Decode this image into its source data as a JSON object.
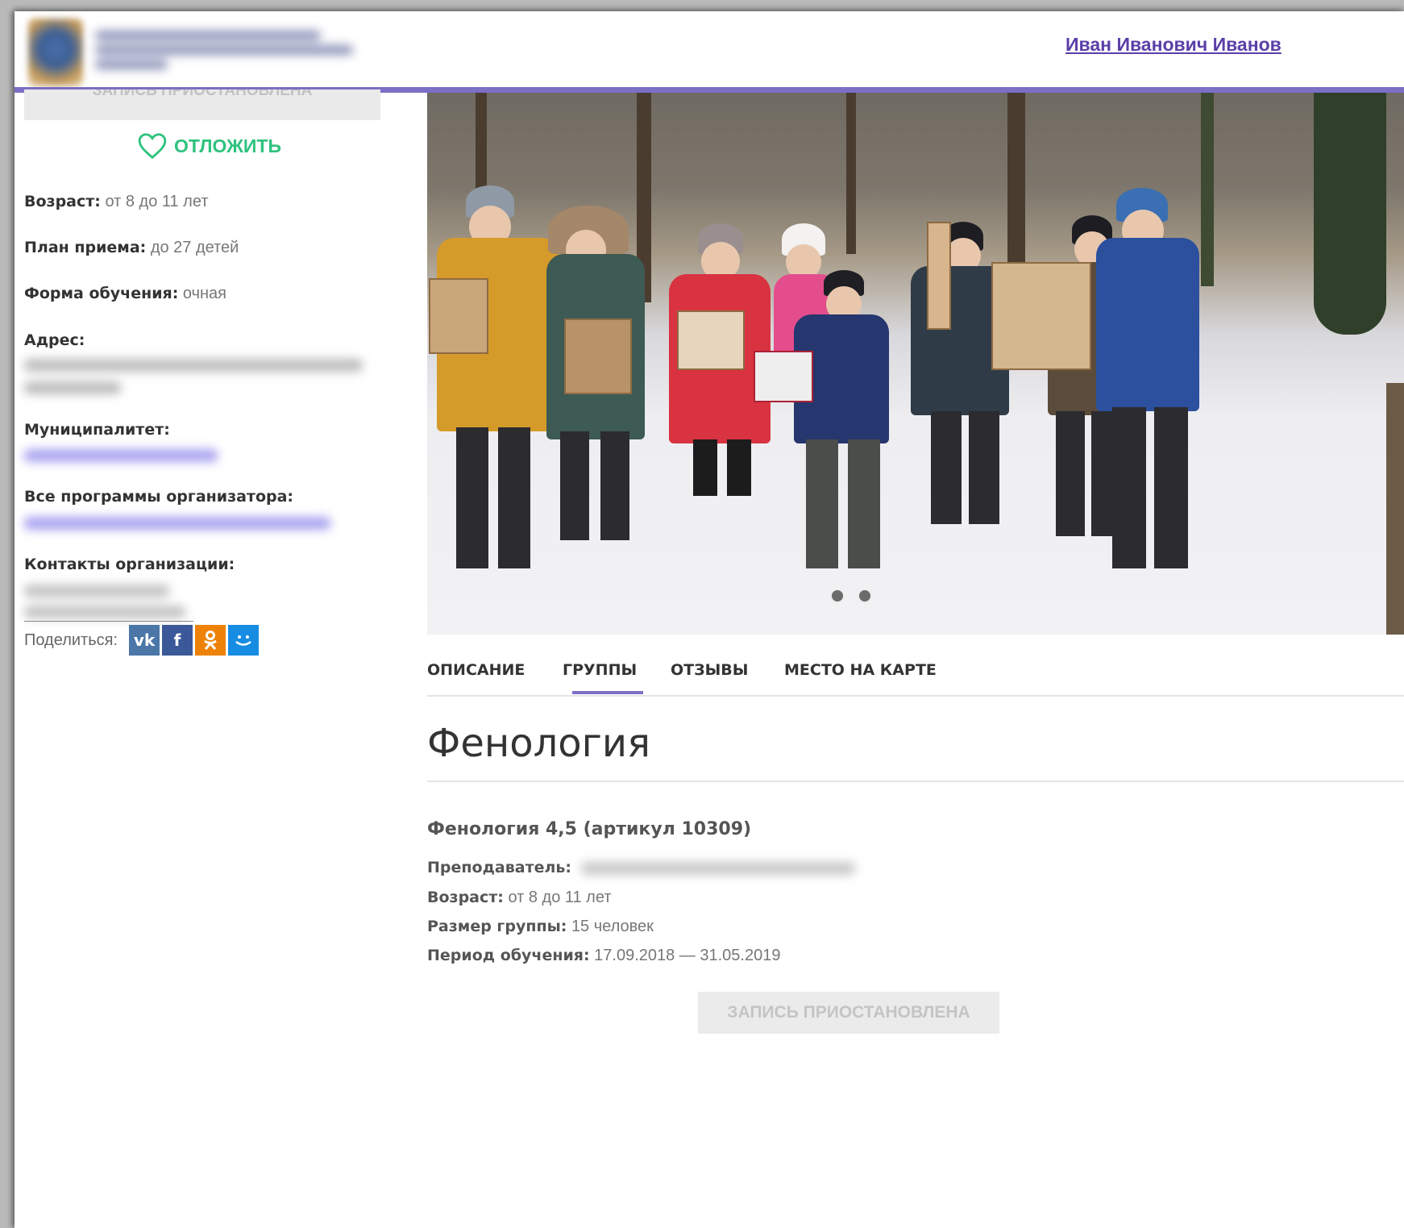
{
  "header": {
    "user_name": "Иван Иванович Иванов"
  },
  "sidebar": {
    "enroll_suspended_label": "ЗАПИСЬ ПРИОСТАНОВЛЕНА",
    "postpone_label": "ОТЛОЖИТЬ",
    "age_label": "Возраст:",
    "age_value": "от 8 до 11 лет",
    "plan_label": "План приема:",
    "plan_value": "до 27 детей",
    "form_label": "Форма обучения:",
    "form_value": "очная",
    "address_label": "Адрес:",
    "municipality_label": "Муниципалитет:",
    "all_programs_label": "Все программы организатора:",
    "contacts_label": "Контакты организации:",
    "share_label": "Поделиться:",
    "share_icons": [
      "vk-icon",
      "facebook-icon",
      "odnoklassniki-icon",
      "mailru-icon"
    ]
  },
  "tabs": [
    {
      "label": "ОПИСАНИЕ"
    },
    {
      "label": "ГРУППЫ",
      "active": true
    },
    {
      "label": "ОТЗЫВЫ"
    },
    {
      "label": "МЕСТО НА КАРТЕ"
    }
  ],
  "program": {
    "title": "Фенология",
    "group_name": "Фенология 4,5 (артикул 10309)",
    "teacher_label": "Преподаватель:",
    "age_label": "Возраст:",
    "age_value": "от 8 до 11  лет",
    "size_label": "Размер группы:",
    "size_value": "15 человек",
    "period_label": "Период обучения:",
    "period_value": "17.09.2018 — 31.05.2019",
    "enroll_suspended_label": "ЗАПИСЬ ПРИОСТАНОВЛЕНА"
  },
  "colors": {
    "accent": "#7b6fc6",
    "postpone_green": "#2ec27e",
    "link_purple": "#5b3fa8",
    "vk": "#4a76a8",
    "facebook": "#3b5998",
    "odnoklassniki": "#ee8208",
    "mailru": "#168de2"
  }
}
